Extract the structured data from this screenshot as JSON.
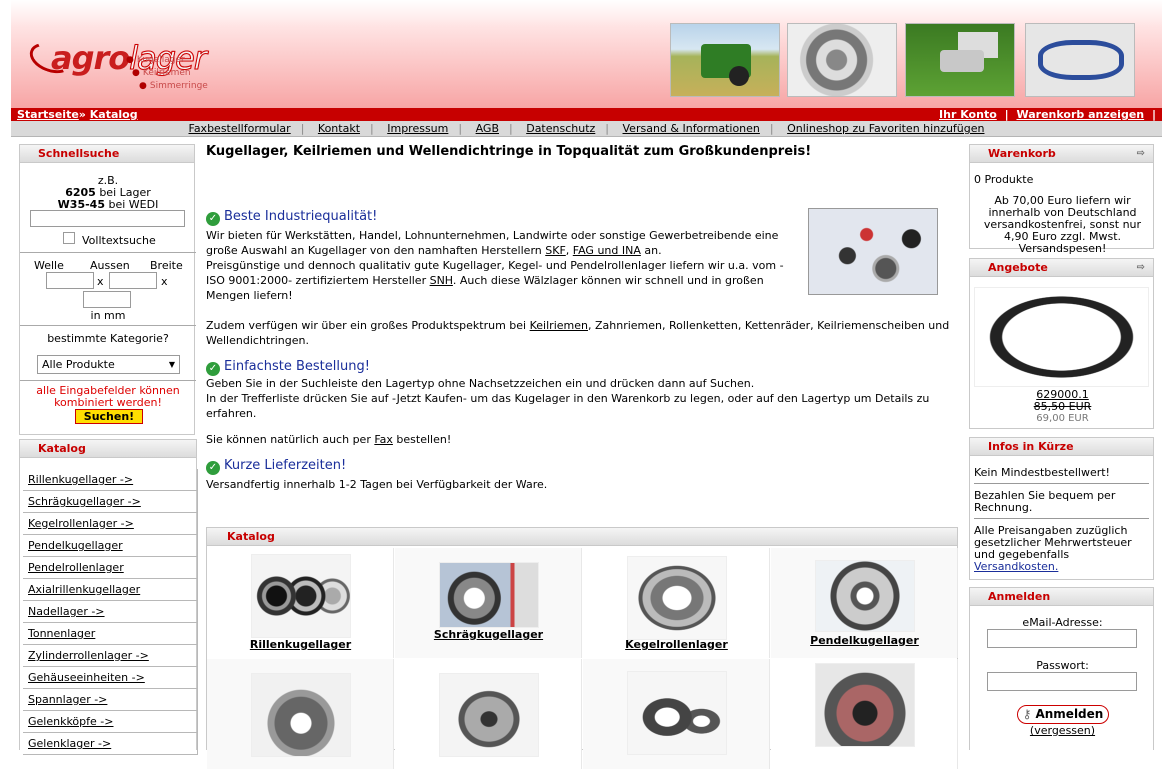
{
  "header": {
    "logo_agro": "agro",
    "logo_lager": "lager",
    "logo_sub": [
      "Kugellager",
      "Keilriemen",
      "Simmerringe"
    ]
  },
  "breadcrumb": {
    "home": "Startseite",
    "sep": "»",
    "catalog": "Katalog"
  },
  "account": {
    "my_account": "Ihr Konto",
    "cart": "Warenkorb anzeigen",
    "sep": "|"
  },
  "nav": [
    "Faxbestellformular",
    "Kontakt",
    "Impressum",
    "AGB",
    "Datenschutz",
    "Versand & Informationen",
    "Onlineshop zu Favoriten hinzufügen"
  ],
  "quick_search": {
    "title": "Schnellsuche",
    "example_label": "z.B.",
    "example1_bold": "6205",
    "example1_rest": "bei Lager",
    "example2_bold": "W35-45",
    "example2_rest": "bei WEDI",
    "fulltext_label": "Volltextsuche",
    "col_welle": "Welle",
    "col_aussen": "Aussen",
    "col_breite": "Breite",
    "times": "x",
    "unit": "in mm",
    "category_label": "bestimmte Kategorie?",
    "category_value": "Alle Produkte",
    "note": "alle Eingabefelder können kombiniert werden!",
    "button": "Suchen!"
  },
  "left_catalog": {
    "title": "Katalog",
    "items": [
      "Rillenkugellager ->",
      "Schrägkugellager ->",
      "Kegelrollenlager ->",
      "Pendelkugellager",
      "Pendelrollenlager",
      "Axialrillenkugellager",
      "Nadellager ->",
      "Tonnenlager",
      "Zylinderrollenlager ->",
      "Gehäuseeinheiten ->",
      "Spannlager ->",
      "Gelenkköpfe ->",
      "Gelenklager ->"
    ]
  },
  "main": {
    "headline": "Kugellager, Keilriemen und Wellendichtringe in Topqualität zum Großkundenpreis!",
    "sec1_title": "Beste Industriequalität!",
    "sec1_p1a": "Wir bieten für Werkstätten, Handel, Lohnunternehmen, Landwirte oder sonstige Gewerbetreibende eine große Auswahl an Kugellager von den namhaften Herstellern ",
    "sec1_link1": "SKF",
    "sec1_comma": ", ",
    "sec1_link2": "FAG und INA",
    "sec1_p1b": " an.",
    "sec1_p2a": "Preisgünstige und dennoch qualitativ gute Kugellager, Kegel- und Pendelrollenlager liefern wir u.a. vom -ISO 9001:2000- zertifiziertem Hersteller ",
    "sec1_link3": "SNH",
    "sec1_p2b": ". Auch diese Wälzlager können wir schnell und in großen Mengen liefern!",
    "sec1_p3a": "Zudem verfügen wir über ein großes Produktspektrum bei ",
    "sec1_link4": "Keilriemen",
    "sec1_p3b": ", Zahnriemen, Rollenketten, Kettenräder, Keilriemenscheiben und Wellendichtringen.",
    "sec2_title": "Einfachste Bestellung!",
    "sec2_p1": "Geben Sie in der Suchleiste den Lagertyp ohne Nachsetzzeichen ein und drücken dann auf Suchen.",
    "sec2_p2": "In der Trefferliste drücken Sie auf -Jetzt Kaufen- um das Kugelager in den Warenkorb zu legen, oder auf den Lagertyp um Details zu erfahren.",
    "sec2_p3a": "Sie können natürlich auch per ",
    "sec2_link": "Fax",
    "sec2_p3b": " bestellen!",
    "sec3_title": "Kurze Lieferzeiten!",
    "sec3_p1": "Versandfertig innerhalb 1-2 Tagen bei Verfügbarkeit der Ware.",
    "catalog_title": "Katalog",
    "catalog_items": [
      "Rillenkugellager",
      "Schrägkugellager",
      "Kegelrollenlager",
      "Pendelkugellager"
    ]
  },
  "cart": {
    "title": "Warenkorb",
    "count": "0 Produkte",
    "info": "Ab 70,00 Euro liefern wir innerhalb von Deutschland versandkostenfrei, sonst nur 4,90 Euro zzgl. Mwst. Versandspesen!"
  },
  "offers": {
    "title": "Angebote",
    "product": "629000.1",
    "old_price": "85,50 EUR",
    "new_price": "69,00 EUR"
  },
  "info_box": {
    "title": "Infos in Kürze",
    "i1": "Kein Mindestbestellwert!",
    "i2": "Bezahlen Sie bequem per Rechnung.",
    "i3": "Alle Preisangaben zuzüglich gesetzlicher Mehrwertsteuer und gegebenfalls",
    "i3_link": "Versandkosten."
  },
  "login": {
    "title": "Anmelden",
    "email_label": "eMail-Adresse:",
    "password_label": "Passwort:",
    "button": "Anmelden",
    "forgot": "(vergessen)"
  },
  "colors": {
    "brand_red": "#c70000",
    "link_blue": "#1a2e9a",
    "check_green": "#2f9d3c"
  }
}
